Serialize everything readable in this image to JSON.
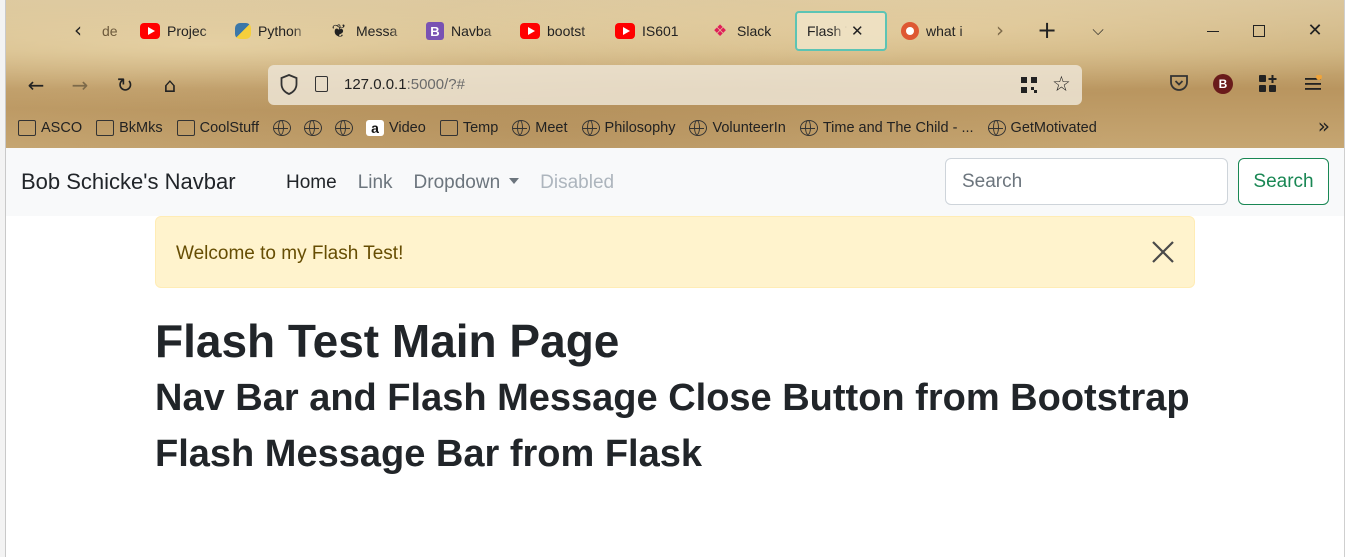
{
  "browser": {
    "tabs": [
      {
        "label": "de",
        "favicon": "nav-back-icon"
      },
      {
        "label": "Projec",
        "favicon": "youtube-icon"
      },
      {
        "label": "Python",
        "favicon": "python-icon"
      },
      {
        "label": "Messa",
        "favicon": "message-icon"
      },
      {
        "label": "Navba",
        "favicon": "bootstrap-icon"
      },
      {
        "label": "bootst",
        "favicon": "youtube-icon"
      },
      {
        "label": "IS601",
        "favicon": "youtube-icon"
      },
      {
        "label": "Slack",
        "favicon": "slack-icon"
      },
      {
        "label": "Flash Te",
        "favicon": "none",
        "active": true
      },
      {
        "label": "what i",
        "favicon": "duckduckgo-icon"
      }
    ],
    "bootstrap_letter": "B",
    "url_host": "127.0.0.1",
    "url_rest": ":5000/?#",
    "account_initial": "B",
    "bookmarks": [
      {
        "label": "ASCO",
        "icon": "folder-icon"
      },
      {
        "label": "BkMks",
        "icon": "folder-icon"
      },
      {
        "label": "CoolStuff",
        "icon": "folder-icon"
      },
      {
        "label": "",
        "icon": "globe-icon"
      },
      {
        "label": "",
        "icon": "globe-icon"
      },
      {
        "label": "",
        "icon": "globe-icon"
      },
      {
        "label": "Video",
        "icon": "amazon-icon"
      },
      {
        "label": "Temp",
        "icon": "folder-icon"
      },
      {
        "label": "Meet",
        "icon": "globe-icon"
      },
      {
        "label": "Philosophy",
        "icon": "globe-icon"
      },
      {
        "label": "VolunteerIn",
        "icon": "globe-icon"
      },
      {
        "label": "Time and The Child - ...",
        "icon": "globe-icon"
      },
      {
        "label": "GetMotivated",
        "icon": "globe-icon"
      }
    ]
  },
  "navbar": {
    "brand": "Bob Schicke's Navbar",
    "links": {
      "home": "Home",
      "link": "Link",
      "dropdown": "Dropdown",
      "disabled": "Disabled"
    },
    "search_placeholder": "Search",
    "search_button": "Search",
    "accent_color": "#198754"
  },
  "alert": {
    "message": "Welcome to my Flash Test!",
    "color": "#fff3cd"
  },
  "content": {
    "title": "Flash Test Main Page",
    "line1": "Nav Bar and Flash Message Close Button from Bootstrap",
    "line2": "Flash Message Bar from Flask"
  }
}
